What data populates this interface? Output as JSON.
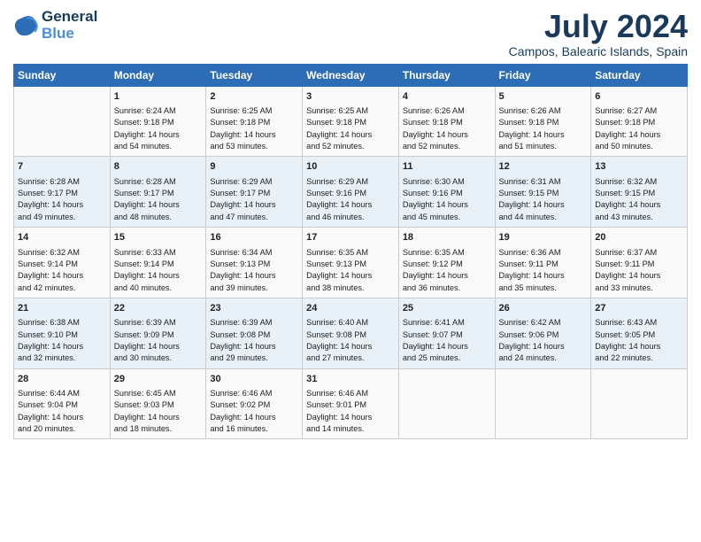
{
  "logo": {
    "line1": "General",
    "line2": "Blue"
  },
  "title": "July 2024",
  "subtitle": "Campos, Balearic Islands, Spain",
  "days_header": [
    "Sunday",
    "Monday",
    "Tuesday",
    "Wednesday",
    "Thursday",
    "Friday",
    "Saturday"
  ],
  "weeks": [
    {
      "cells": [
        {
          "day": "",
          "info": ""
        },
        {
          "day": "1",
          "info": "Sunrise: 6:24 AM\nSunset: 9:18 PM\nDaylight: 14 hours\nand 54 minutes."
        },
        {
          "day": "2",
          "info": "Sunrise: 6:25 AM\nSunset: 9:18 PM\nDaylight: 14 hours\nand 53 minutes."
        },
        {
          "day": "3",
          "info": "Sunrise: 6:25 AM\nSunset: 9:18 PM\nDaylight: 14 hours\nand 52 minutes."
        },
        {
          "day": "4",
          "info": "Sunrise: 6:26 AM\nSunset: 9:18 PM\nDaylight: 14 hours\nand 52 minutes."
        },
        {
          "day": "5",
          "info": "Sunrise: 6:26 AM\nSunset: 9:18 PM\nDaylight: 14 hours\nand 51 minutes."
        },
        {
          "day": "6",
          "info": "Sunrise: 6:27 AM\nSunset: 9:18 PM\nDaylight: 14 hours\nand 50 minutes."
        }
      ]
    },
    {
      "cells": [
        {
          "day": "7",
          "info": "Sunrise: 6:28 AM\nSunset: 9:17 PM\nDaylight: 14 hours\nand 49 minutes."
        },
        {
          "day": "8",
          "info": "Sunrise: 6:28 AM\nSunset: 9:17 PM\nDaylight: 14 hours\nand 48 minutes."
        },
        {
          "day": "9",
          "info": "Sunrise: 6:29 AM\nSunset: 9:17 PM\nDaylight: 14 hours\nand 47 minutes."
        },
        {
          "day": "10",
          "info": "Sunrise: 6:29 AM\nSunset: 9:16 PM\nDaylight: 14 hours\nand 46 minutes."
        },
        {
          "day": "11",
          "info": "Sunrise: 6:30 AM\nSunset: 9:16 PM\nDaylight: 14 hours\nand 45 minutes."
        },
        {
          "day": "12",
          "info": "Sunrise: 6:31 AM\nSunset: 9:15 PM\nDaylight: 14 hours\nand 44 minutes."
        },
        {
          "day": "13",
          "info": "Sunrise: 6:32 AM\nSunset: 9:15 PM\nDaylight: 14 hours\nand 43 minutes."
        }
      ]
    },
    {
      "cells": [
        {
          "day": "14",
          "info": "Sunrise: 6:32 AM\nSunset: 9:14 PM\nDaylight: 14 hours\nand 42 minutes."
        },
        {
          "day": "15",
          "info": "Sunrise: 6:33 AM\nSunset: 9:14 PM\nDaylight: 14 hours\nand 40 minutes."
        },
        {
          "day": "16",
          "info": "Sunrise: 6:34 AM\nSunset: 9:13 PM\nDaylight: 14 hours\nand 39 minutes."
        },
        {
          "day": "17",
          "info": "Sunrise: 6:35 AM\nSunset: 9:13 PM\nDaylight: 14 hours\nand 38 minutes."
        },
        {
          "day": "18",
          "info": "Sunrise: 6:35 AM\nSunset: 9:12 PM\nDaylight: 14 hours\nand 36 minutes."
        },
        {
          "day": "19",
          "info": "Sunrise: 6:36 AM\nSunset: 9:11 PM\nDaylight: 14 hours\nand 35 minutes."
        },
        {
          "day": "20",
          "info": "Sunrise: 6:37 AM\nSunset: 9:11 PM\nDaylight: 14 hours\nand 33 minutes."
        }
      ]
    },
    {
      "cells": [
        {
          "day": "21",
          "info": "Sunrise: 6:38 AM\nSunset: 9:10 PM\nDaylight: 14 hours\nand 32 minutes."
        },
        {
          "day": "22",
          "info": "Sunrise: 6:39 AM\nSunset: 9:09 PM\nDaylight: 14 hours\nand 30 minutes."
        },
        {
          "day": "23",
          "info": "Sunrise: 6:39 AM\nSunset: 9:08 PM\nDaylight: 14 hours\nand 29 minutes."
        },
        {
          "day": "24",
          "info": "Sunrise: 6:40 AM\nSunset: 9:08 PM\nDaylight: 14 hours\nand 27 minutes."
        },
        {
          "day": "25",
          "info": "Sunrise: 6:41 AM\nSunset: 9:07 PM\nDaylight: 14 hours\nand 25 minutes."
        },
        {
          "day": "26",
          "info": "Sunrise: 6:42 AM\nSunset: 9:06 PM\nDaylight: 14 hours\nand 24 minutes."
        },
        {
          "day": "27",
          "info": "Sunrise: 6:43 AM\nSunset: 9:05 PM\nDaylight: 14 hours\nand 22 minutes."
        }
      ]
    },
    {
      "cells": [
        {
          "day": "28",
          "info": "Sunrise: 6:44 AM\nSunset: 9:04 PM\nDaylight: 14 hours\nand 20 minutes."
        },
        {
          "day": "29",
          "info": "Sunrise: 6:45 AM\nSunset: 9:03 PM\nDaylight: 14 hours\nand 18 minutes."
        },
        {
          "day": "30",
          "info": "Sunrise: 6:46 AM\nSunset: 9:02 PM\nDaylight: 14 hours\nand 16 minutes."
        },
        {
          "day": "31",
          "info": "Sunrise: 6:46 AM\nSunset: 9:01 PM\nDaylight: 14 hours\nand 14 minutes."
        },
        {
          "day": "",
          "info": ""
        },
        {
          "day": "",
          "info": ""
        },
        {
          "day": "",
          "info": ""
        }
      ]
    }
  ]
}
